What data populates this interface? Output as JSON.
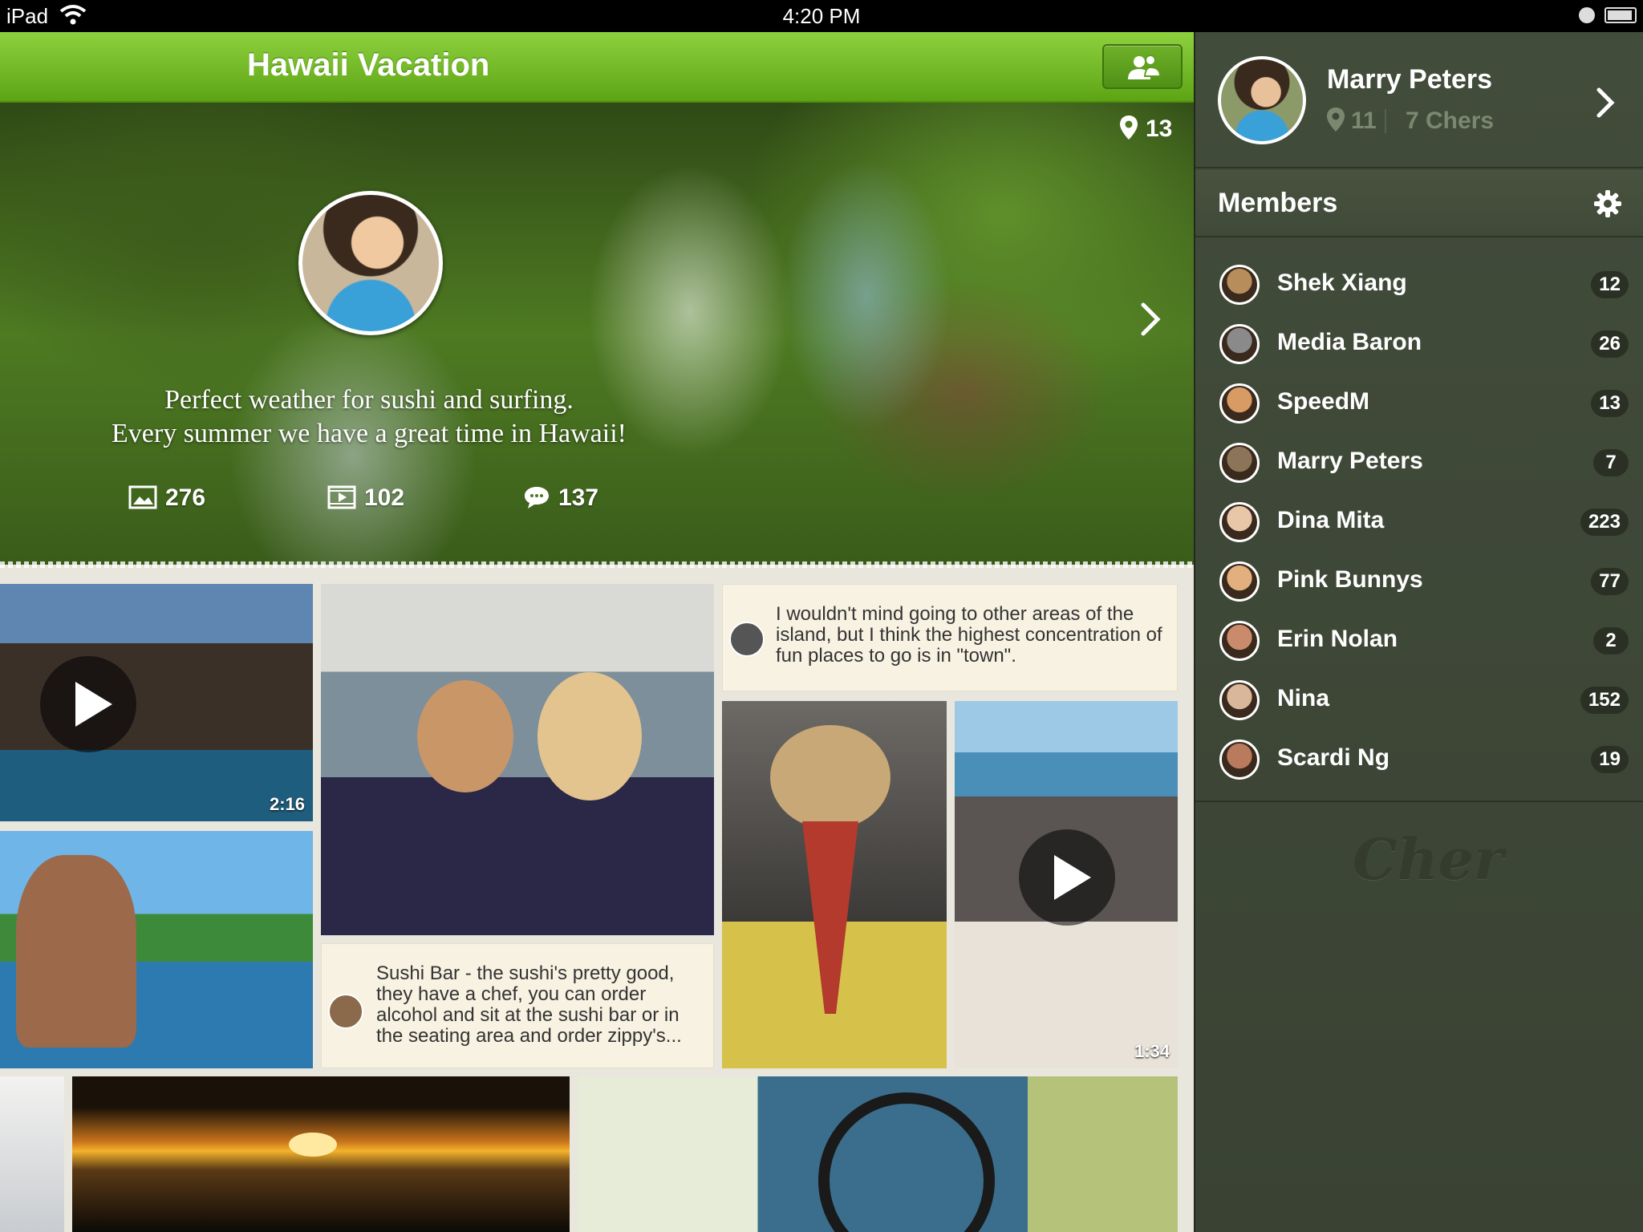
{
  "status_bar": {
    "device": "iPad",
    "time": "4:20 PM"
  },
  "header": {
    "title": "Hawaii Vacation",
    "members_button_icon": "group-icon"
  },
  "hero": {
    "location_count": "13",
    "caption_line1": "Perfect weather for sushi and surfing.",
    "caption_line2": "Every summer we have a great time in Hawaii!",
    "stats": {
      "photos": "276",
      "videos": "102",
      "comments": "137"
    }
  },
  "grid": {
    "video1_duration": "2:16",
    "video2_duration": "1:34",
    "note1": "I wouldn't mind going to other areas of the island, but I think the highest concentration of fun places to go is in \"town\".",
    "note2": "Sushi Bar - the sushi's pretty good, they have a chef, you can order alcohol and sit at the sushi bar or in the seating area and order zippy's..."
  },
  "sidebar": {
    "profile": {
      "name": "Marry Peters",
      "pins": "11",
      "chers": "7 Chers"
    },
    "members_title": "Members",
    "members": [
      {
        "name": "Shek Xiang",
        "count": "12",
        "color": "#b88d5c"
      },
      {
        "name": "Media Baron",
        "count": "26",
        "color": "#8a8a8a"
      },
      {
        "name": "SpeedM",
        "count": "13",
        "color": "#d79b63"
      },
      {
        "name": "Marry Peters",
        "count": "7",
        "color": "#8c7458"
      },
      {
        "name": "Dina Mita",
        "count": "223",
        "color": "#e8c6a8"
      },
      {
        "name": "Pink Bunnys",
        "count": "77",
        "color": "#e2b07e"
      },
      {
        "name": "Erin Nolan",
        "count": "2",
        "color": "#c98b6b"
      },
      {
        "name": "Nina",
        "count": "152",
        "color": "#d9b79a"
      },
      {
        "name": "Scardi Ng",
        "count": "19",
        "color": "#b97a5e"
      }
    ],
    "brand": "Cher"
  },
  "colors": {
    "accent_green": "#6cb624",
    "sidebar_bg": "#3f4838",
    "note_bg": "#f7f2e2"
  }
}
